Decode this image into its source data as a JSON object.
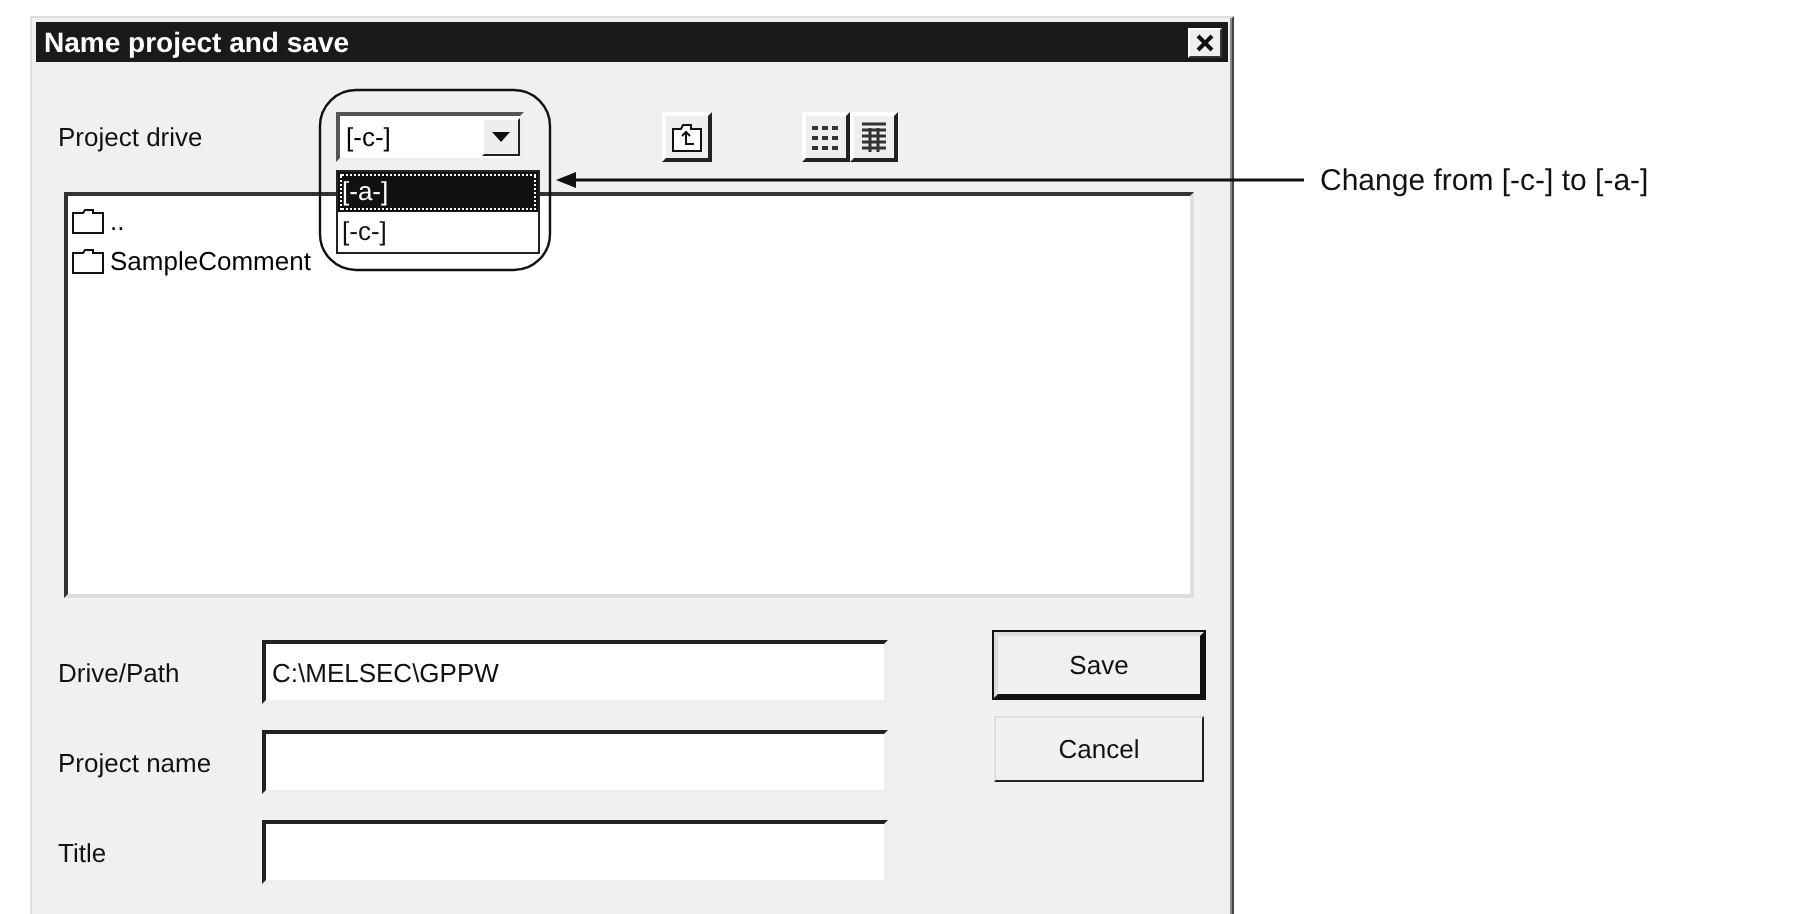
{
  "window": {
    "title": "Name project and save"
  },
  "project_drive": {
    "label": "Project drive",
    "value": "[-c-]",
    "expanded": true,
    "options": [
      {
        "label": "[-a-]",
        "highlighted": true
      },
      {
        "label": "[-c-]",
        "highlighted": false
      }
    ]
  },
  "file_list": {
    "items": [
      {
        "name": ".."
      },
      {
        "name": "SampleComment"
      }
    ]
  },
  "fields": [
    {
      "label": "Drive/Path",
      "value": "C:\\MELSEC\\GPPW"
    },
    {
      "label": "Project name"
    },
    {
      "label": "Title"
    }
  ],
  "buttons": [
    {
      "label": "Save",
      "default": true
    },
    {
      "label": "Cancel",
      "default": false
    }
  ],
  "annotation": {
    "text": "Change from [-c-] to [-a-]"
  }
}
